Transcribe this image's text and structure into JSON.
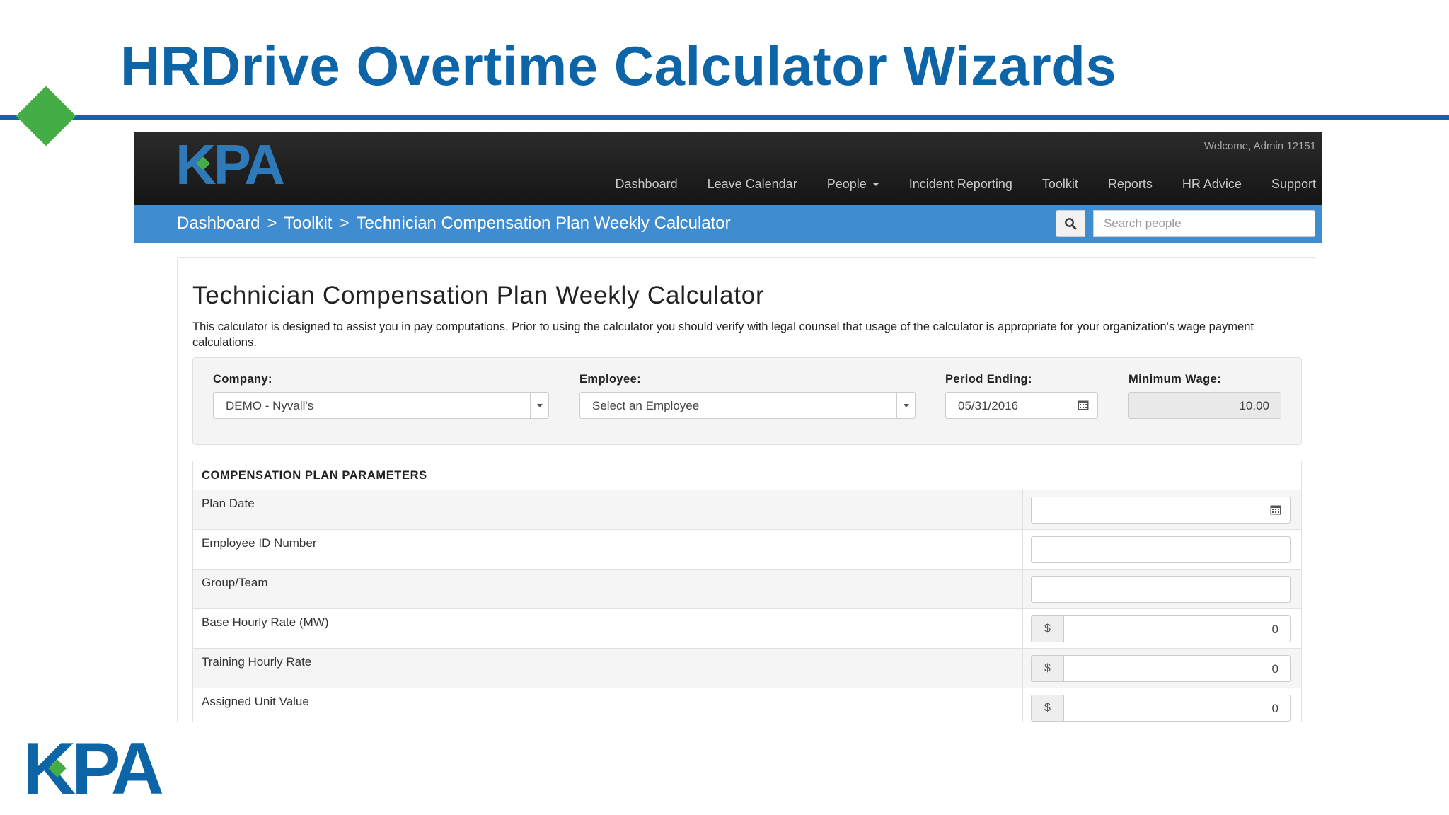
{
  "slide": {
    "title": "HRDrive Overtime Calculator Wizards",
    "logo_text": "KPA",
    "accent_color": "#45ad45",
    "brand_color": "#0d65a8"
  },
  "app": {
    "logo_text": "KPA",
    "welcome": "Welcome, Admin 12151",
    "nav": {
      "dashboard": "Dashboard",
      "leave_calendar": "Leave Calendar",
      "people": "People",
      "incident_reporting": "Incident Reporting",
      "toolkit": "Toolkit",
      "reports": "Reports",
      "hr_advice": "HR Advice",
      "support": "Support"
    },
    "breadcrumb": {
      "dashboard": "Dashboard",
      "sep1": ">",
      "toolkit": "Toolkit",
      "sep2": ">",
      "current": "Technician Compensation Plan Weekly Calculator"
    },
    "search": {
      "placeholder": "Search people",
      "icon": "search-icon"
    },
    "crumbbar_color": "#3f8cd0"
  },
  "calculator": {
    "title": "Technician Compensation Plan Weekly Calculator",
    "description": "This calculator is designed to assist you in pay computations. Prior to using the calculator you should verify with legal counsel that usage of the calculator is appropriate for your organization's wage payment calculations.",
    "filters": {
      "company_label": "Company:",
      "company_value": "DEMO - Nyvall's",
      "employee_label": "Employee:",
      "employee_value": "Select an Employee",
      "period_label": "Period Ending:",
      "period_value": "05/31/2016",
      "wage_label": "Minimum Wage:",
      "wage_value": "10.00"
    },
    "params": {
      "heading": "COMPENSATION PLAN PARAMETERS",
      "rows": [
        {
          "label": "Plan Date",
          "value": ""
        },
        {
          "label": "Employee ID Number",
          "value": ""
        },
        {
          "label": "Group/Team",
          "value": ""
        },
        {
          "label": "Base Hourly Rate (MW)",
          "prefix": "$",
          "value": "0"
        },
        {
          "label": "Training Hourly Rate",
          "prefix": "$",
          "value": "0"
        },
        {
          "label": "Assigned Unit Value",
          "prefix": "$",
          "value": "0"
        }
      ]
    }
  }
}
